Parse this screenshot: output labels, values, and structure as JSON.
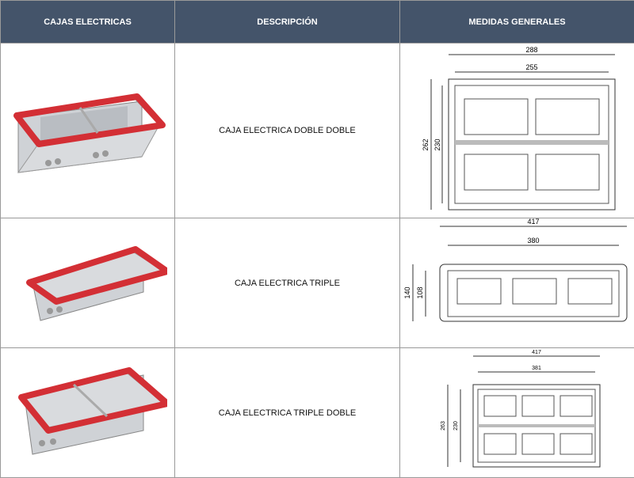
{
  "header": {
    "col1": "CAJAS ELECTRICAS",
    "col2": "DESCRIPCIÓN",
    "col3": "MEDIDAS GENERALES"
  },
  "rows": [
    {
      "description": "CAJA ELECTRICA DOBLE DOBLE",
      "dims": {
        "outer_width": "288",
        "inner_width": "255",
        "outer_height": "262",
        "inner_height": "230"
      }
    },
    {
      "description": "CAJA ELECTRICA TRIPLE",
      "dims": {
        "outer_width": "417",
        "inner_width": "380",
        "outer_height": "140",
        "inner_height": "108"
      }
    },
    {
      "description": "CAJA ELECTRICA TRIPLE DOBLE",
      "dims": {
        "outer_width": "417",
        "inner_width": "381",
        "outer_height": "263",
        "inner_height": "230"
      }
    }
  ],
  "colors": {
    "header_bg": "#44546a",
    "frame_red": "#d32f35"
  }
}
